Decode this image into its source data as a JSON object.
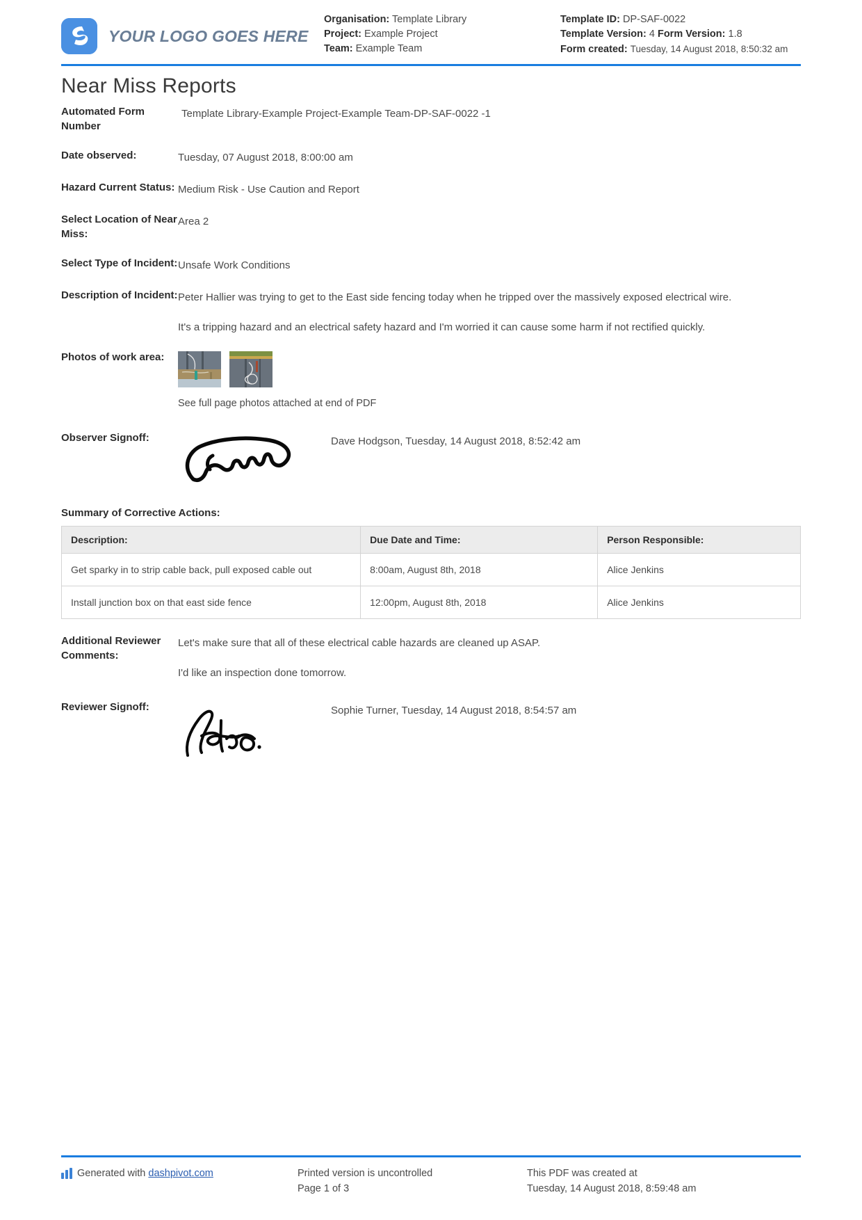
{
  "header": {
    "logo_text": "YOUR LOGO GOES HERE",
    "organisation_label": "Organisation:",
    "organisation_value": "Template Library",
    "project_label": "Project:",
    "project_value": "Example Project",
    "team_label": "Team:",
    "team_value": "Example Team",
    "template_id_label": "Template ID:",
    "template_id_value": "DP-SAF-0022",
    "template_version_label": "Template Version:",
    "template_version_value": "4",
    "form_version_label": "Form Version:",
    "form_version_value": "1.8",
    "form_created_label": "Form created:",
    "form_created_value": "Tuesday, 14 August 2018, 8:50:32 am"
  },
  "title": "Near Miss Reports",
  "fields": {
    "automated_form_number_label": "Automated Form Number",
    "automated_form_number_value": "Template Library-Example Project-Example Team-DP-SAF-0022   -1",
    "date_observed_label": "Date observed:",
    "date_observed_value": "Tuesday, 07 August 2018, 8:00:00 am",
    "hazard_status_label": "Hazard Current Status:",
    "hazard_status_value": "Medium Risk - Use Caution and Report",
    "location_label": "Select Location of Near Miss:",
    "location_value": "Area 2",
    "incident_type_label": "Select Type of Incident:",
    "incident_type_value": "Unsafe Work Conditions",
    "description_label": "Description of Incident:",
    "description_p1": "Peter Hallier was trying to get to the East side fencing today when he tripped over the massively exposed electrical wire.",
    "description_p2": "It's a tripping hazard and an electrical safety hazard and I'm worried it can cause some harm if not rectified quickly.",
    "photos_label": "Photos of work area:",
    "photos_caption": "See full page photos attached at end of PDF",
    "observer_signoff_label": "Observer Signoff:",
    "observer_signoff_value": "Dave Hodgson, Tuesday, 14 August 2018, 8:52:42 am",
    "reviewer_comments_label": "Additional Reviewer Comments:",
    "reviewer_comments_p1": "Let's make sure that all of these electrical cable hazards are cleaned up ASAP.",
    "reviewer_comments_p2": "I'd like an inspection done tomorrow.",
    "reviewer_signoff_label": "Reviewer Signoff:",
    "reviewer_signoff_value": "Sophie Turner, Tuesday, 14 August 2018, 8:54:57 am"
  },
  "corrective_actions": {
    "heading": "Summary of Corrective Actions:",
    "columns": [
      "Description:",
      "Due Date and Time:",
      "Person Responsible:"
    ],
    "rows": [
      {
        "description": "Get sparky in to strip cable back, pull exposed cable out",
        "due": "8:00am, August 8th, 2018",
        "person": "Alice Jenkins"
      },
      {
        "description": "Install junction box on that east side fence",
        "due": "12:00pm, August 8th, 2018",
        "person": "Alice Jenkins"
      }
    ]
  },
  "footer": {
    "generated_prefix": "Generated with ",
    "generated_link": "dashpivot.com",
    "uncontrolled": "Printed version is uncontrolled",
    "page_number": "Page 1 of 3",
    "pdf_created_label": "This PDF was created at",
    "pdf_created_value": "Tuesday, 14 August 2018, 8:59:48 am"
  },
  "colors": {
    "accent_blue": "#1a7de0",
    "logo_blue": "#4a90e2",
    "table_header_bg": "#ececec"
  }
}
